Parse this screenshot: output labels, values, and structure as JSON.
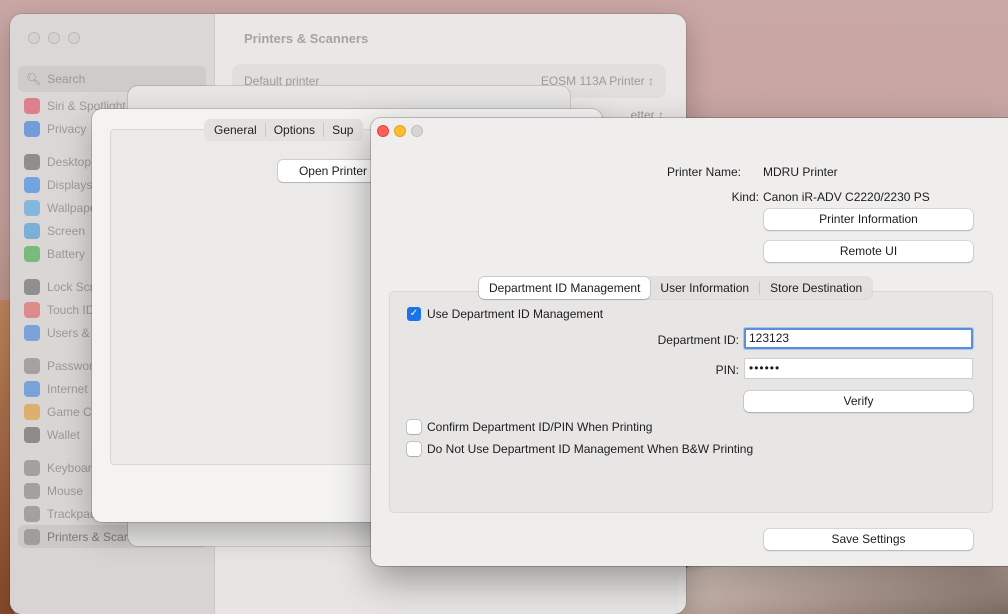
{
  "settings": {
    "title": "Printers & Scanners",
    "search_placeholder": "Search",
    "default_printer_label": "Default printer",
    "default_printer_value": "EOSM 113A Printer",
    "sidebar": [
      {
        "label": "Siri & Spotlight"
      },
      {
        "label": "Privacy"
      },
      {
        "label": "Desktop"
      },
      {
        "label": "Displays"
      },
      {
        "label": "Wallpaper"
      },
      {
        "label": "Screen"
      },
      {
        "label": "Battery"
      },
      {
        "label": "Lock Screen"
      },
      {
        "label": "Touch ID"
      },
      {
        "label": "Users &"
      },
      {
        "label": "Passwords"
      },
      {
        "label": "Internet"
      },
      {
        "label": "Game Center"
      },
      {
        "label": "Wallet"
      },
      {
        "label": "Keyboard"
      },
      {
        "label": "Mouse"
      },
      {
        "label": "Trackpad"
      },
      {
        "label": "Printers & Scanners"
      }
    ],
    "mid_sheet_right": "etter"
  },
  "options_dialog": {
    "tabs": [
      "General",
      "Options",
      "Sup"
    ],
    "open_printer_button": "Open Printer"
  },
  "canon_dialog": {
    "printer_name_label": "Printer Name:",
    "printer_name_value": "MDRU Printer",
    "kind_label": "Kind:",
    "kind_value": "Canon iR-ADV C2220/2230 PS",
    "printer_info_button": "Printer Information",
    "remote_ui_button": "Remote UI",
    "tabs": [
      "Department ID Management",
      "User Information",
      "Store Destination"
    ],
    "active_tab": "Department ID Management",
    "use_dept_id_label": "Use Department ID Management",
    "use_dept_id_checked": true,
    "dept_id_label": "Department ID:",
    "dept_id_value": "123123",
    "pin_label": "PIN:",
    "pin_value": "••••••",
    "verify_button": "Verify",
    "confirm_label": "Confirm Department ID/PIN When Printing",
    "confirm_checked": false,
    "no_bw_label": "Do Not Use Department ID Management When B&W Printing",
    "no_bw_checked": false,
    "save_button": "Save Settings"
  },
  "colors": {
    "accent": "#1a73e8",
    "close": "#ff5f57",
    "minimize": "#febc2e",
    "focus_ring": "#5b8fd8"
  }
}
